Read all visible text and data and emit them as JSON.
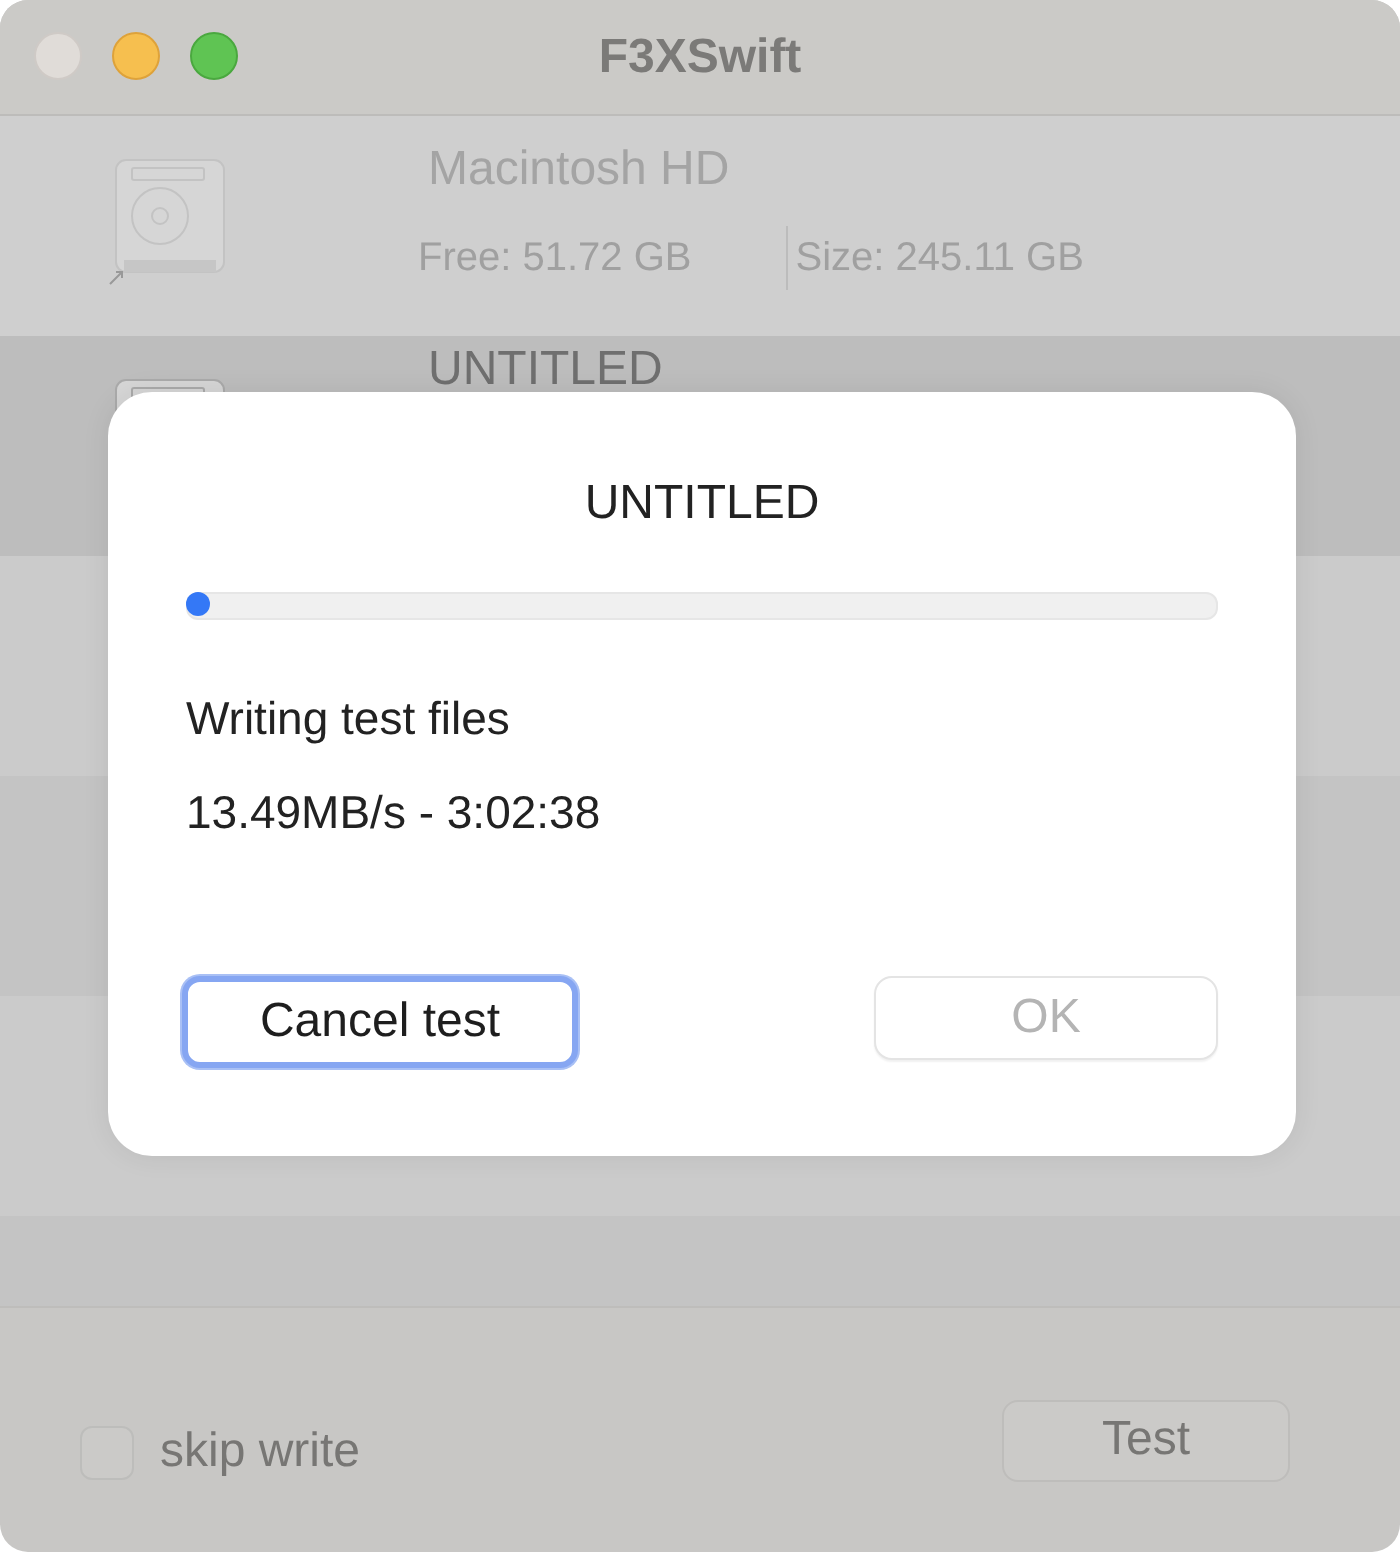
{
  "window": {
    "title": "F3XSwift"
  },
  "drives": [
    {
      "name": "Macintosh HD",
      "free": "Free: 51.72 GB",
      "size": "Size: 245.11 GB",
      "selected": false
    },
    {
      "name": "UNTITLED",
      "selected": true
    }
  ],
  "sheet": {
    "title": "UNTITLED",
    "progress": {
      "level": 0.02
    },
    "status": "Writing test files",
    "speed": "13.49MB/s - 3:02:38",
    "buttons": [
      {
        "label": "Cancel test",
        "kind": "default"
      },
      {
        "label": "OK",
        "kind": "disabled"
      }
    ]
  },
  "footer": {
    "skip_write": {
      "label": "skip write",
      "checked": false
    },
    "test_button": "Test"
  }
}
